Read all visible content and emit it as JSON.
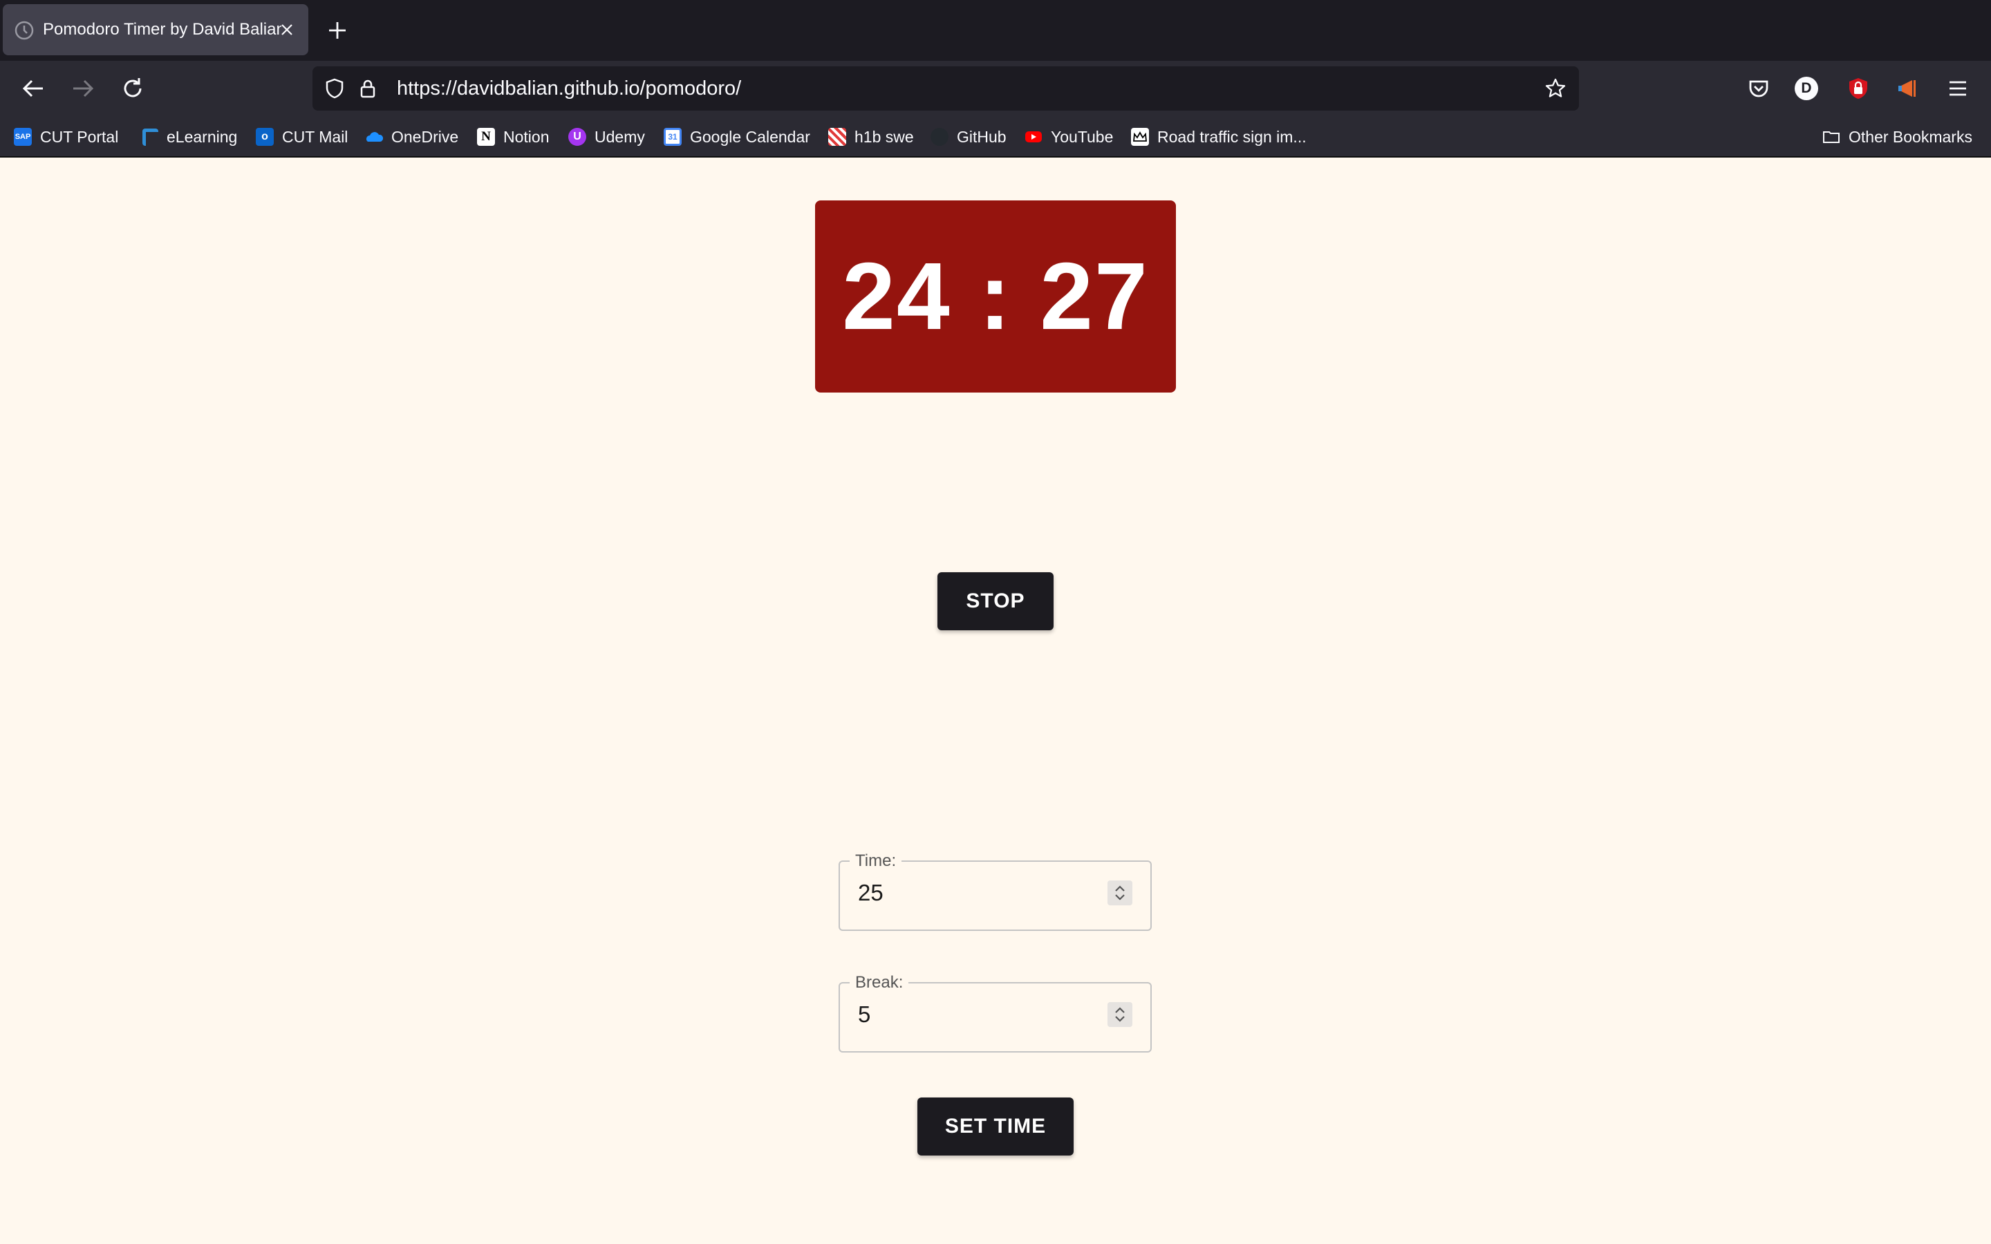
{
  "browser": {
    "tab": {
      "title": "Pomodoro Timer by David Balian"
    },
    "url": "https://davidbalian.github.io/pomodoro/",
    "bookmarks": [
      {
        "label": "CUT Portal",
        "icon": "sap-icon",
        "color": "#1a73e8"
      },
      {
        "label": "eLearning",
        "icon": "elearning-icon",
        "color": "#2f8fd8"
      },
      {
        "label": "CUT Mail",
        "icon": "outlook-icon",
        "color": "#0a64c8"
      },
      {
        "label": "OneDrive",
        "icon": "onedrive-icon",
        "color": "#1e90ff"
      },
      {
        "label": "Notion",
        "icon": "notion-icon",
        "color": "#ffffff"
      },
      {
        "label": "Udemy",
        "icon": "udemy-icon",
        "color": "#a435f0"
      },
      {
        "label": "Google Calendar",
        "icon": "google-calendar-icon",
        "color": "#4285f4"
      },
      {
        "label": "h1b swe",
        "icon": "h1b-icon",
        "color": "#e03a3a"
      },
      {
        "label": "GitHub",
        "icon": "github-icon",
        "color": "#24292f"
      },
      {
        "label": "YouTube",
        "icon": "youtube-icon",
        "color": "#ff0000"
      },
      {
        "label": "Road traffic sign im...",
        "icon": "crown-icon",
        "color": "#ffffff"
      }
    ],
    "other_bookmarks": "Other Bookmarks",
    "profile_initial": "D"
  },
  "timer": {
    "display": "24 : 27",
    "background": "#95140e"
  },
  "controls": {
    "stop_label": "STOP",
    "set_time_label": "SET TIME"
  },
  "fields": {
    "time": {
      "label": "Time:",
      "value": "25"
    },
    "break": {
      "label": "Break:",
      "value": "5"
    }
  }
}
